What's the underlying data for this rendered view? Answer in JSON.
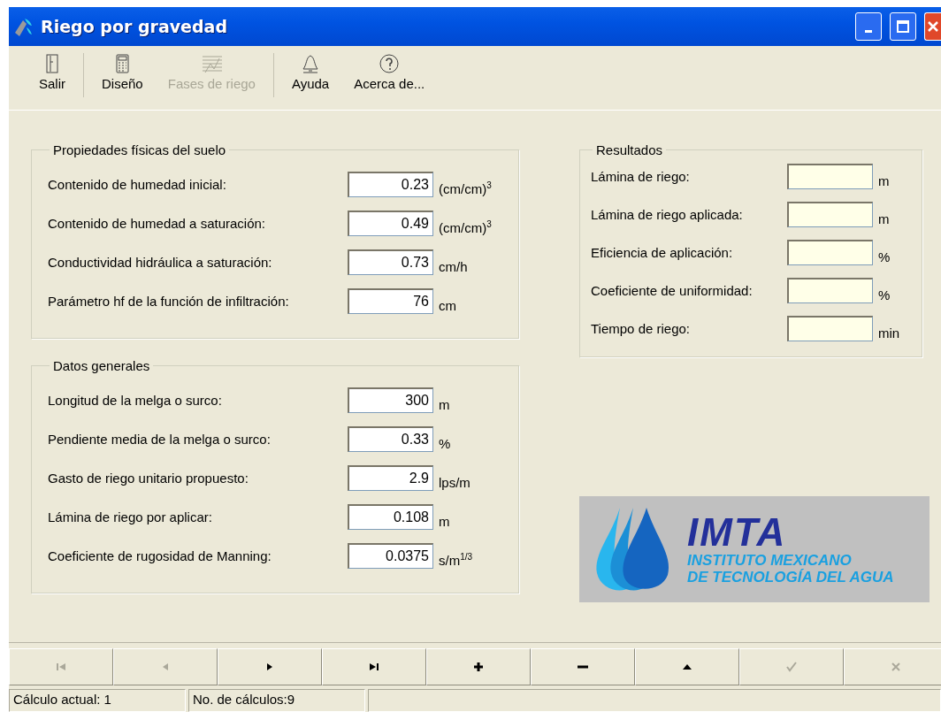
{
  "window": {
    "title": "Riego por gravedad"
  },
  "toolbar": {
    "groups": [
      [
        {
          "kind": "exit",
          "label": "Salir",
          "disabled": false
        }
      ],
      [
        {
          "kind": "calculator",
          "label": "Diseño",
          "disabled": false
        },
        {
          "kind": "chart",
          "label": "Fases de riego",
          "disabled": true
        }
      ],
      [
        {
          "kind": "help",
          "label": "Ayuda",
          "disabled": false
        },
        {
          "kind": "about",
          "label": "Acerca de...",
          "disabled": false
        }
      ]
    ]
  },
  "soil_properties": {
    "title": "Propiedades físicas del suelo",
    "fields": [
      {
        "label": "Contenido de humedad inicial:",
        "value": "0.23",
        "unit": "(cm/cm)$^{3}$"
      },
      {
        "label": "Contenido de humedad a saturación:",
        "value": "0.49",
        "unit": "(cm/cm)$^{3}$"
      },
      {
        "label": "Conductividad hidráulica a saturación:",
        "value": "0.73",
        "unit": "cm/h"
      },
      {
        "label": "Parámetro hf de la función de infiltración:",
        "value": "76",
        "unit": "cm"
      }
    ]
  },
  "general_data": {
    "title": "Datos generales",
    "fields": [
      {
        "label": "Longitud de la melga o surco:",
        "value": "300",
        "unit": "m"
      },
      {
        "label": "Pendiente media de la melga o surco:",
        "value": "0.33",
        "unit": "%"
      },
      {
        "label": "Gasto de riego unitario propuesto:",
        "value": "2.9",
        "unit": "lps/m"
      },
      {
        "label": "Lámina de riego por aplicar:",
        "value": "0.108",
        "unit": "m"
      },
      {
        "label": "Coeficiente de rugosidad de Manning:",
        "value": "0.0375",
        "unit": "s/m$^{1/3}$"
      }
    ]
  },
  "results": {
    "title": "Resultados",
    "fields": [
      {
        "label": "Lámina de riego:",
        "unit": "m"
      },
      {
        "label": "Lámina de riego aplicada:",
        "unit": "m"
      },
      {
        "label": "Eficiencia de aplicación:",
        "unit": "%"
      },
      {
        "label": "Coeficiente de uniformidad:",
        "unit": "%"
      },
      {
        "label": "Tiempo de riego:",
        "unit": "min"
      }
    ]
  },
  "logo": {
    "acronym": "IMTA",
    "lines": [
      "INSTITUTO MEXICANO",
      "DE TECNOLOGÍA DEL AGUA"
    ]
  },
  "navigation": [
    {
      "kind": "first",
      "disabled": true
    },
    {
      "kind": "prev",
      "disabled": true
    },
    {
      "kind": "next",
      "disabled": false
    },
    {
      "kind": "last",
      "disabled": false
    },
    {
      "kind": "add",
      "disabled": false
    },
    {
      "kind": "remove",
      "disabled": false
    },
    {
      "kind": "up",
      "disabled": false
    },
    {
      "kind": "confirm",
      "disabled": true
    },
    {
      "kind": "cancel",
      "disabled": true
    }
  ],
  "status_bar": [
    "Cálculo actual: 1",
    "No. de cálculos:9"
  ]
}
